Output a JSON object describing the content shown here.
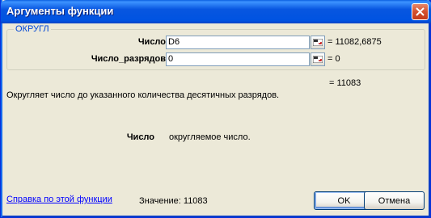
{
  "window": {
    "title": "Аргументы функции"
  },
  "group": {
    "label": "ОКРУГЛ"
  },
  "args": [
    {
      "label": "Число",
      "value": "D6",
      "result": "= 11082,6875"
    },
    {
      "label": "Число_разрядов",
      "value": "0",
      "result": "= 0"
    }
  ],
  "final_result": "= 11083",
  "description": "Округляет число до указанного количества десятичных разрядов.",
  "arg_help": {
    "name": "Число",
    "text": "округляемое число."
  },
  "footer": {
    "help_link": "Справка по этой функции",
    "value_line": "Значение:   11083",
    "ok_label": "OK",
    "cancel_label": "Отмена"
  },
  "colors": {
    "titlebar": "#0053e1",
    "group_label": "#0046d5",
    "link": "#0000ff",
    "close_button": "#d4502e"
  },
  "icons": [
    "close-icon",
    "range-select-icon"
  ]
}
